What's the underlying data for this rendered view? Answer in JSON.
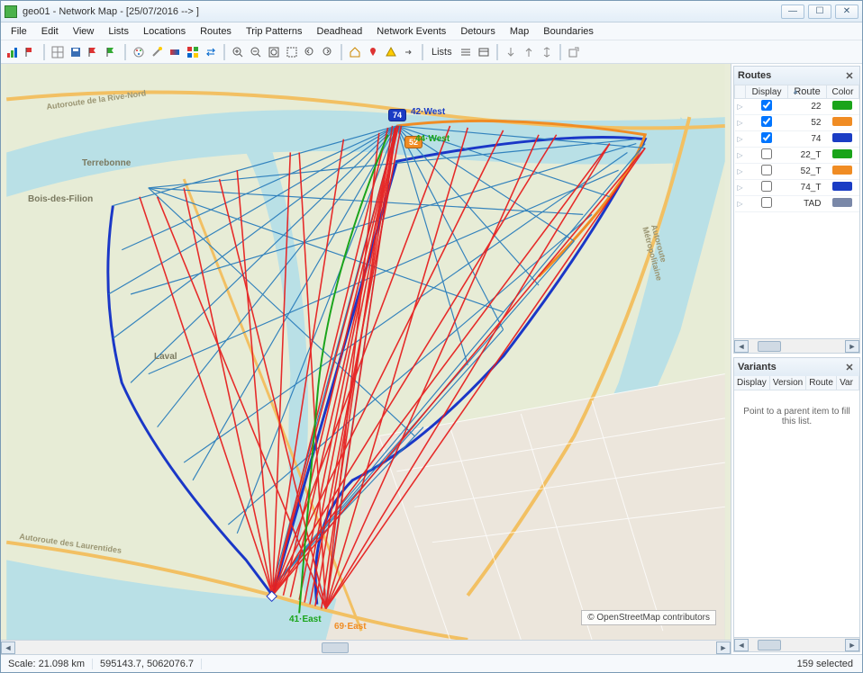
{
  "window": {
    "title": "geo01 - Network Map - [25/07/2016 --> ]"
  },
  "menu": [
    "File",
    "Edit",
    "View",
    "Lists",
    "Locations",
    "Routes",
    "Trip Patterns",
    "Deadhead",
    "Network Events",
    "Detours",
    "Map",
    "Boundaries"
  ],
  "toolbar_lists_label": "Lists",
  "routes_panel": {
    "title": "Routes",
    "cols": [
      "Display",
      "Route",
      "Color"
    ],
    "rows": [
      {
        "checked": true,
        "route": "22",
        "color": "#1aa41a"
      },
      {
        "checked": true,
        "route": "52",
        "color": "#f08c24"
      },
      {
        "checked": true,
        "route": "74",
        "color": "#1a3cc4"
      },
      {
        "checked": false,
        "route": "22_T",
        "color": "#1aa41a"
      },
      {
        "checked": false,
        "route": "52_T",
        "color": "#f08c24"
      },
      {
        "checked": false,
        "route": "74_T",
        "color": "#1a3cc4"
      },
      {
        "checked": false,
        "route": "TAD",
        "color": "#7a88a8"
      }
    ]
  },
  "variants_panel": {
    "title": "Variants",
    "cols": [
      "Display",
      "Version",
      "Route",
      "Var"
    ],
    "hint": "Point to a parent item to fill this list."
  },
  "map": {
    "attribution": "© OpenStreetMap contributors",
    "places": {
      "terrebonne": "Terrebonne",
      "bois": "Bois-des-Filion",
      "laval": "Laval",
      "autoroute_nord": "Autoroute de la Rive-Nord",
      "autoroute_laur": "Autoroute des Laurentides",
      "autoroute_metro": "Autoroute Métropolitaine"
    },
    "labels": {
      "r42w": "42·West",
      "r44w": "44·West",
      "r41e": "41·East",
      "r69e": "69·East"
    },
    "badges": {
      "b74": "74",
      "b52": "52"
    }
  },
  "status": {
    "scale": "Scale: 21.098 km",
    "coords": "595143.7, 5062076.7",
    "selected": "159 selected"
  }
}
